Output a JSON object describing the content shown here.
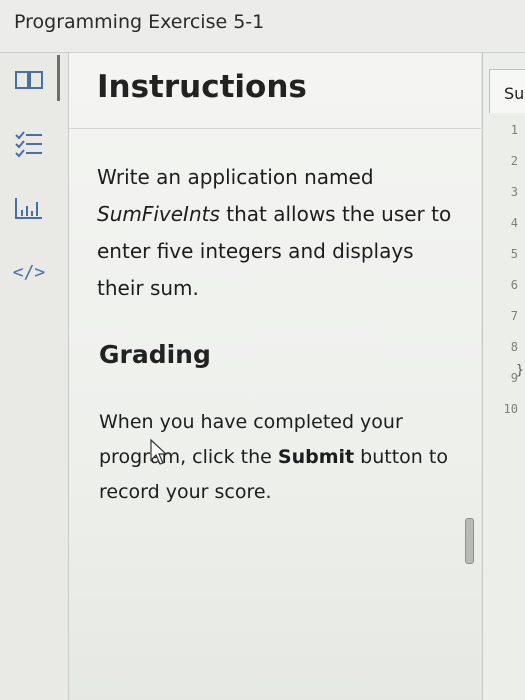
{
  "header": {
    "title": "Programming Exercise 5-1"
  },
  "rail": {
    "icons": [
      "book-icon",
      "checklist-icon",
      "chart-icon",
      "code-icon"
    ],
    "code_label": "</>"
  },
  "instructions": {
    "title": "Instructions",
    "text_before": "Write an application named ",
    "code_name": "SumFiveInts",
    "text_after": " that allows the user to enter five integers and displays their sum."
  },
  "grading": {
    "title": "Grading",
    "text_before": "When you have completed your program, click the ",
    "bold_word": "Submit",
    "text_after": " button to record your score."
  },
  "editor": {
    "tab_label": "Su",
    "line_numbers": [
      "1",
      "2",
      "3",
      "4",
      "5",
      "6",
      "7",
      "8",
      "9",
      "10"
    ],
    "brace": "}"
  },
  "colors": {
    "background": "#e4e6e2",
    "panel": "#f4f5f2",
    "text": "#1d1d1d"
  }
}
